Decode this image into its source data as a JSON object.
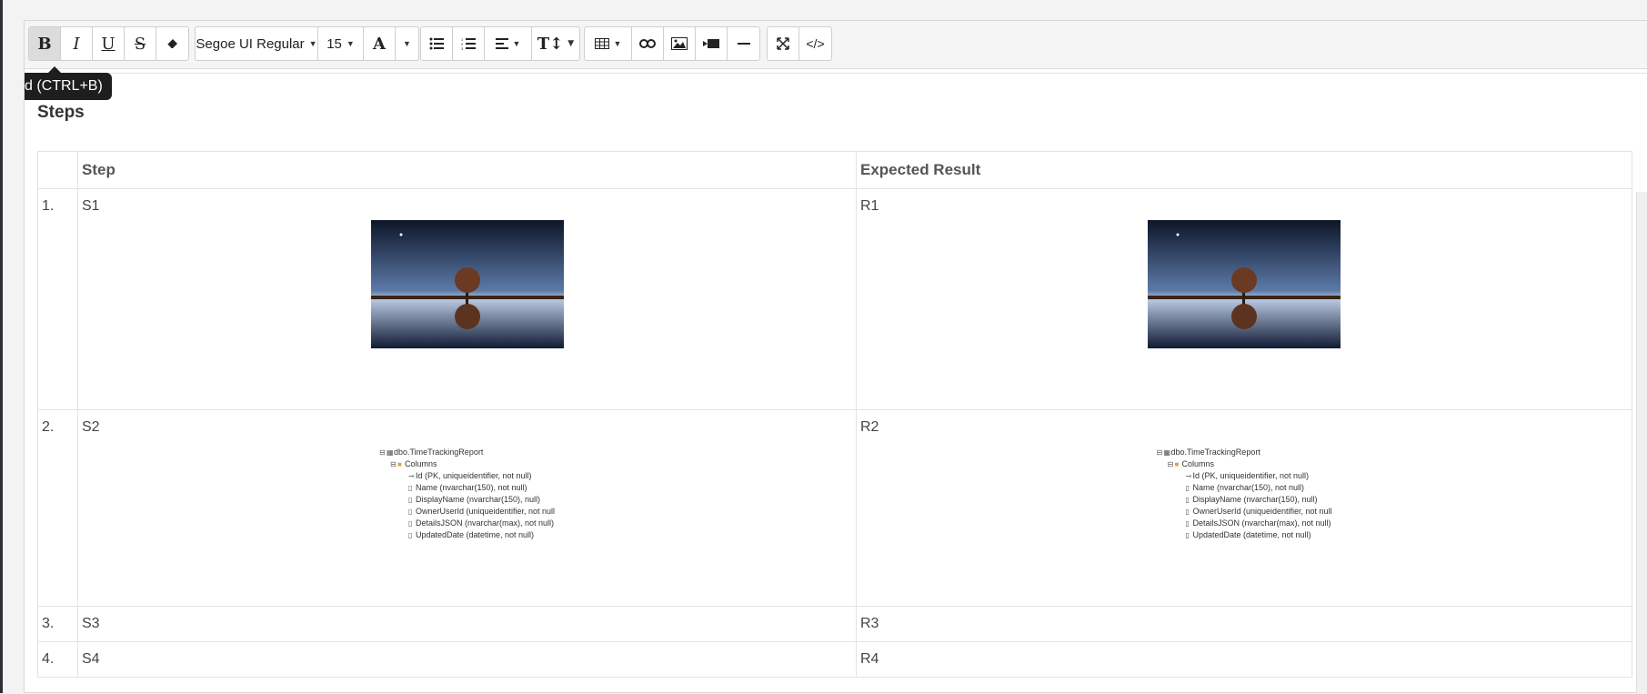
{
  "toolbar": {
    "font_name": "Segoe UI Regular",
    "font_size": "15",
    "tooltip": "d (CTRL+B)"
  },
  "editor": {
    "heading": "Steps",
    "table": {
      "headers": [
        "Step",
        "Expected Result"
      ],
      "rows": [
        {
          "num": "1.",
          "step": "S1",
          "result": "R1"
        },
        {
          "num": "2.",
          "step": "S2",
          "result": "R2"
        },
        {
          "num": "3.",
          "step": "S3",
          "result": "R3"
        },
        {
          "num": "4.",
          "step": "S4",
          "result": "R4"
        }
      ]
    },
    "schema": {
      "table_name": "dbo.TimeTrackingReport",
      "folder": "Columns",
      "columns": [
        "Id (PK, uniqueidentifier, not null)",
        "Name (nvarchar(150), not null)",
        "DisplayName (nvarchar(150), null)",
        "OwnerUserId (uniqueidentifier, not null",
        "DetailsJSON (nvarchar(max), not null)",
        "UpdatedDate (datetime, not null)"
      ]
    }
  },
  "colors": {
    "tooltip_bg": "#1e1e1e",
    "active_button": "#dcdcdc"
  }
}
